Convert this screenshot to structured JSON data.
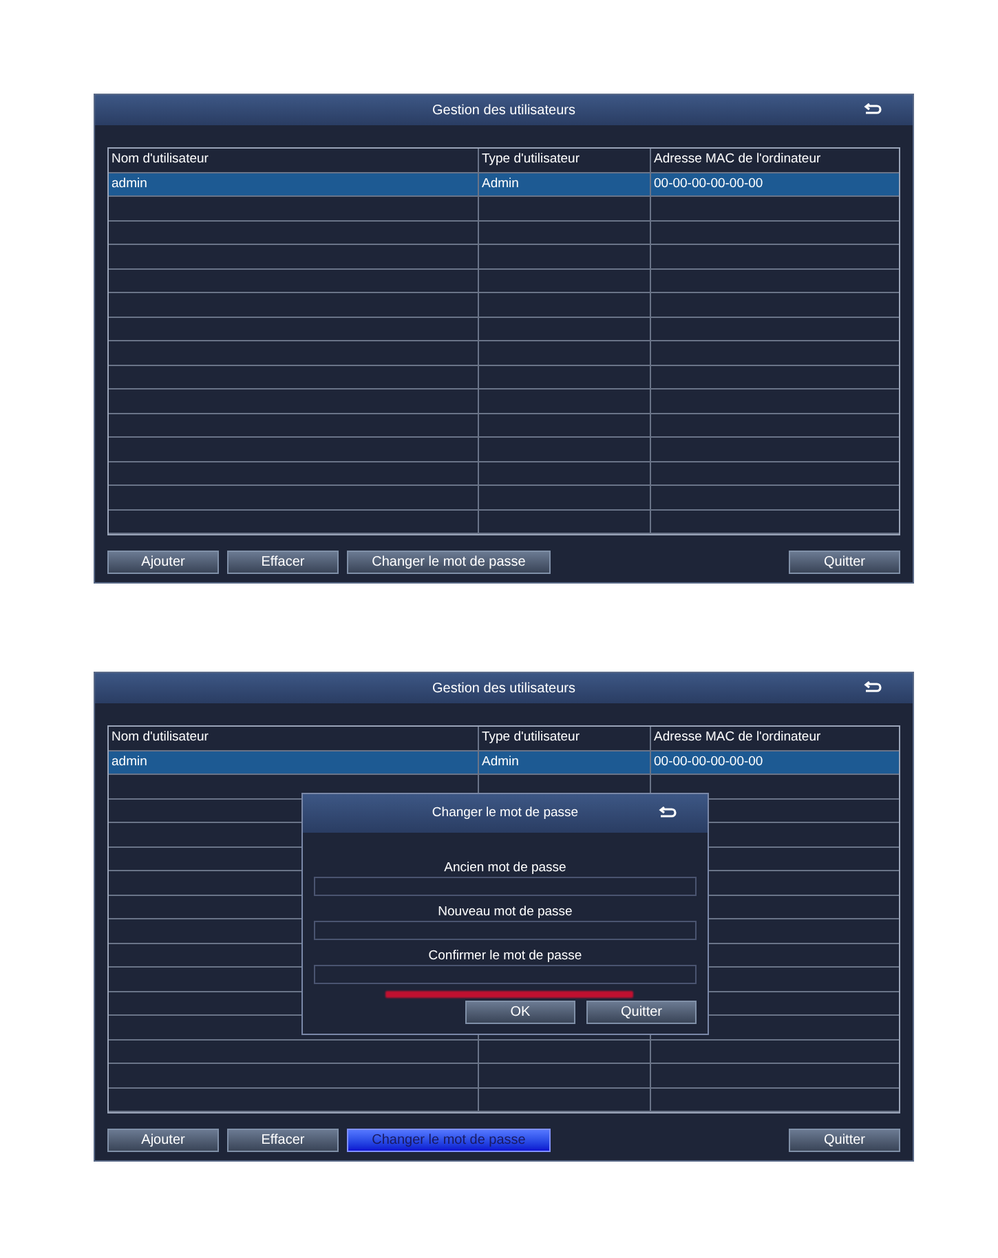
{
  "screens": [
    {
      "title": "Gestion des utilisateurs",
      "columns": [
        "Nom d'utilisateur",
        "Type d'utilisateur",
        "Adresse MAC de l'ordinateur"
      ],
      "rows": [
        {
          "cells": [
            "admin",
            "Admin",
            "00-00-00-00-00-00"
          ],
          "selected": true
        }
      ],
      "buttons": [
        {
          "label": "Ajouter",
          "selected": false
        },
        {
          "label": "Effacer",
          "selected": false
        },
        {
          "label": "Changer le mot de passe",
          "selected": false
        }
      ],
      "quit_button": "Quitter"
    },
    {
      "title": "Gestion des utilisateurs",
      "columns": [
        "Nom d'utilisateur",
        "Type d'utilisateur",
        "Adresse MAC de l'ordinateur"
      ],
      "rows": [
        {
          "cells": [
            "admin",
            "Admin",
            "00-00-00-00-00-00"
          ],
          "selected": true
        }
      ],
      "buttons": [
        {
          "label": "Ajouter",
          "selected": false
        },
        {
          "label": "Effacer",
          "selected": false
        },
        {
          "label": "Changer le mot de passe",
          "selected": true
        }
      ],
      "quit_button": "Quitter",
      "dialog": {
        "title": "Changer le mot de passe",
        "fields": [
          {
            "label": "Ancien mot de passe"
          },
          {
            "label": "Nouveau mot de passe"
          },
          {
            "label": "Confirmer le mot de passe"
          }
        ],
        "error_shown": true,
        "ok_button": "OK",
        "quit_button": "Quitter"
      }
    }
  ]
}
